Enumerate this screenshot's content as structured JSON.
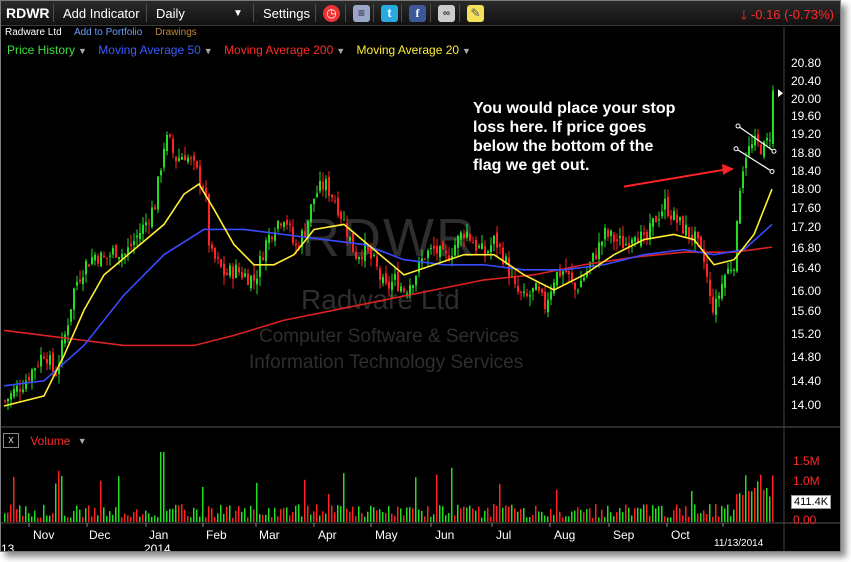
{
  "toolbar": {
    "ticker": "RDWR",
    "add_indicator": "Add Indicator",
    "period": "Daily",
    "settings": "Settings",
    "change": "-0.16 (-0.73%)"
  },
  "subheader": {
    "company": "Radware Ltd",
    "add_to_portfolio": "Add to Portfolio",
    "drawings": "Drawings"
  },
  "indicators": [
    {
      "label": "Price History",
      "color": "#3dde3d"
    },
    {
      "label": "Moving Average 50",
      "color": "#3a5bff"
    },
    {
      "label": "Moving Average 200",
      "color": "#ff2a2a"
    },
    {
      "label": "Moving Average 20",
      "color": "#ffee33"
    }
  ],
  "watermark": {
    "ticker": "RDWR",
    "company": "Radware Ltd",
    "sector": "Computer Software & Services",
    "industry": "Information Technology Services"
  },
  "annotation": "You would place your stop loss here. If price goes below the bottom of the flag we get out.",
  "price_axis": [
    "20.80",
    "20.40",
    "20.00",
    "19.60",
    "19.20",
    "18.80",
    "18.40",
    "18.00",
    "17.60",
    "17.20",
    "16.80",
    "16.40",
    "16.00",
    "15.60",
    "15.20",
    "14.80",
    "14.40",
    "14.00"
  ],
  "months": [
    "Nov",
    "Dec",
    "Jan",
    "Feb",
    "Mar",
    "Apr",
    "May",
    "Jun",
    "Jul",
    "Aug",
    "Sep",
    "Oct"
  ],
  "year_labels": {
    "left": "13",
    "year": "2014"
  },
  "volume": {
    "label": "Volume",
    "axis": [
      "1.5M",
      "1.0M",
      "0.00"
    ],
    "last": "411.4K"
  },
  "last_date": "11/13/2014",
  "colors": {
    "up": "#22dd22",
    "down": "#ff2222",
    "ma20": "#ffee33",
    "ma50": "#3a4bff",
    "ma200": "#dd2222",
    "arrow": "#ff2222"
  },
  "chart_data": {
    "type": "candlestick",
    "x_range": [
      "2013-10",
      "2014-11-13"
    ],
    "ylim": [
      14.0,
      20.8
    ],
    "close_path": [
      [
        0,
        14.1
      ],
      [
        10,
        14.3
      ],
      [
        20,
        14.5
      ],
      [
        30,
        14.8
      ],
      [
        40,
        15.1
      ],
      [
        50,
        14.6
      ],
      [
        60,
        15.4
      ],
      [
        70,
        16.4
      ],
      [
        80,
        16.8
      ],
      [
        90,
        17.0
      ],
      [
        100,
        16.9
      ],
      [
        110,
        17.1
      ],
      [
        120,
        17.0
      ],
      [
        130,
        17.3
      ],
      [
        140,
        17.6
      ],
      [
        150,
        18.0
      ],
      [
        160,
        19.3
      ],
      [
        165,
        19.2
      ],
      [
        170,
        18.9
      ],
      [
        180,
        19.0
      ],
      [
        190,
        18.7
      ],
      [
        200,
        18.3
      ],
      [
        205,
        17.0
      ],
      [
        210,
        16.9
      ],
      [
        220,
        16.6
      ],
      [
        230,
        16.7
      ],
      [
        240,
        16.6
      ],
      [
        250,
        16.5
      ],
      [
        260,
        17.2
      ],
      [
        270,
        17.6
      ],
      [
        280,
        17.8
      ],
      [
        290,
        17.1
      ],
      [
        300,
        17.5
      ],
      [
        310,
        18.2
      ],
      [
        320,
        18.4
      ],
      [
        330,
        18.1
      ],
      [
        340,
        17.6
      ],
      [
        350,
        17.0
      ],
      [
        360,
        17.1
      ],
      [
        370,
        16.8
      ],
      [
        380,
        16.3
      ],
      [
        390,
        16.5
      ],
      [
        400,
        16.3
      ],
      [
        410,
        16.6
      ],
      [
        420,
        17.0
      ],
      [
        430,
        17.1
      ],
      [
        440,
        16.9
      ],
      [
        450,
        17.2
      ],
      [
        460,
        17.5
      ],
      [
        470,
        17.2
      ],
      [
        480,
        17.0
      ],
      [
        490,
        17.3
      ],
      [
        500,
        16.9
      ],
      [
        510,
        16.3
      ],
      [
        520,
        16.1
      ],
      [
        530,
        16.3
      ],
      [
        540,
        16.0
      ],
      [
        550,
        16.6
      ],
      [
        560,
        16.7
      ],
      [
        570,
        16.3
      ],
      [
        580,
        16.6
      ],
      [
        590,
        17.0
      ],
      [
        600,
        17.4
      ],
      [
        610,
        17.3
      ],
      [
        620,
        17.2
      ],
      [
        630,
        17.5
      ],
      [
        640,
        17.2
      ],
      [
        650,
        17.7
      ],
      [
        660,
        18.0
      ],
      [
        670,
        17.7
      ],
      [
        680,
        17.5
      ],
      [
        690,
        17.3
      ],
      [
        700,
        16.8
      ],
      [
        705,
        16.1
      ],
      [
        710,
        15.9
      ],
      [
        715,
        16.3
      ],
      [
        720,
        16.6
      ],
      [
        730,
        16.9
      ],
      [
        735,
        18.4
      ],
      [
        740,
        19.0
      ],
      [
        750,
        19.2
      ],
      [
        760,
        19.1
      ],
      [
        765,
        19.4
      ],
      [
        768,
        20.2
      ]
    ],
    "ma20": [
      [
        0,
        14.0
      ],
      [
        40,
        14.2
      ],
      [
        60,
        15.0
      ],
      [
        80,
        15.9
      ],
      [
        100,
        16.6
      ],
      [
        130,
        17.1
      ],
      [
        160,
        17.6
      ],
      [
        180,
        18.2
      ],
      [
        195,
        18.4
      ],
      [
        210,
        17.9
      ],
      [
        230,
        17.2
      ],
      [
        250,
        16.8
      ],
      [
        270,
        16.8
      ],
      [
        290,
        17.0
      ],
      [
        310,
        17.5
      ],
      [
        340,
        17.6
      ],
      [
        370,
        17.1
      ],
      [
        400,
        16.6
      ],
      [
        430,
        16.8
      ],
      [
        460,
        17.0
      ],
      [
        490,
        17.0
      ],
      [
        520,
        16.6
      ],
      [
        550,
        16.3
      ],
      [
        580,
        16.6
      ],
      [
        610,
        17.0
      ],
      [
        640,
        17.3
      ],
      [
        670,
        17.4
      ],
      [
        690,
        17.3
      ],
      [
        710,
        16.8
      ],
      [
        730,
        16.9
      ],
      [
        750,
        17.4
      ],
      [
        768,
        18.3
      ]
    ],
    "ma50": [
      [
        0,
        14.4
      ],
      [
        40,
        14.5
      ],
      [
        80,
        15.2
      ],
      [
        120,
        16.2
      ],
      [
        160,
        17.0
      ],
      [
        200,
        17.5
      ],
      [
        240,
        17.5
      ],
      [
        280,
        17.4
      ],
      [
        320,
        17.3
      ],
      [
        360,
        17.2
      ],
      [
        400,
        16.9
      ],
      [
        440,
        16.8
      ],
      [
        480,
        16.8
      ],
      [
        520,
        16.7
      ],
      [
        560,
        16.7
      ],
      [
        600,
        16.8
      ],
      [
        640,
        17.0
      ],
      [
        680,
        17.1
      ],
      [
        710,
        17.0
      ],
      [
        740,
        17.1
      ],
      [
        768,
        17.6
      ]
    ],
    "ma200": [
      [
        0,
        15.5
      ],
      [
        60,
        15.35
      ],
      [
        120,
        15.2
      ],
      [
        190,
        15.2
      ],
      [
        230,
        15.4
      ],
      [
        280,
        15.7
      ],
      [
        330,
        15.9
      ],
      [
        380,
        16.1
      ],
      [
        430,
        16.3
      ],
      [
        480,
        16.5
      ],
      [
        530,
        16.6
      ],
      [
        580,
        16.8
      ],
      [
        630,
        16.95
      ],
      [
        680,
        17.05
      ],
      [
        730,
        17.05
      ],
      [
        768,
        17.15
      ]
    ],
    "x_tick_labels": [
      "Nov",
      "Dec",
      "Jan",
      "Feb",
      "Mar",
      "Apr",
      "May",
      "Jun",
      "Jul",
      "Aug",
      "Sep",
      "Oct"
    ]
  }
}
